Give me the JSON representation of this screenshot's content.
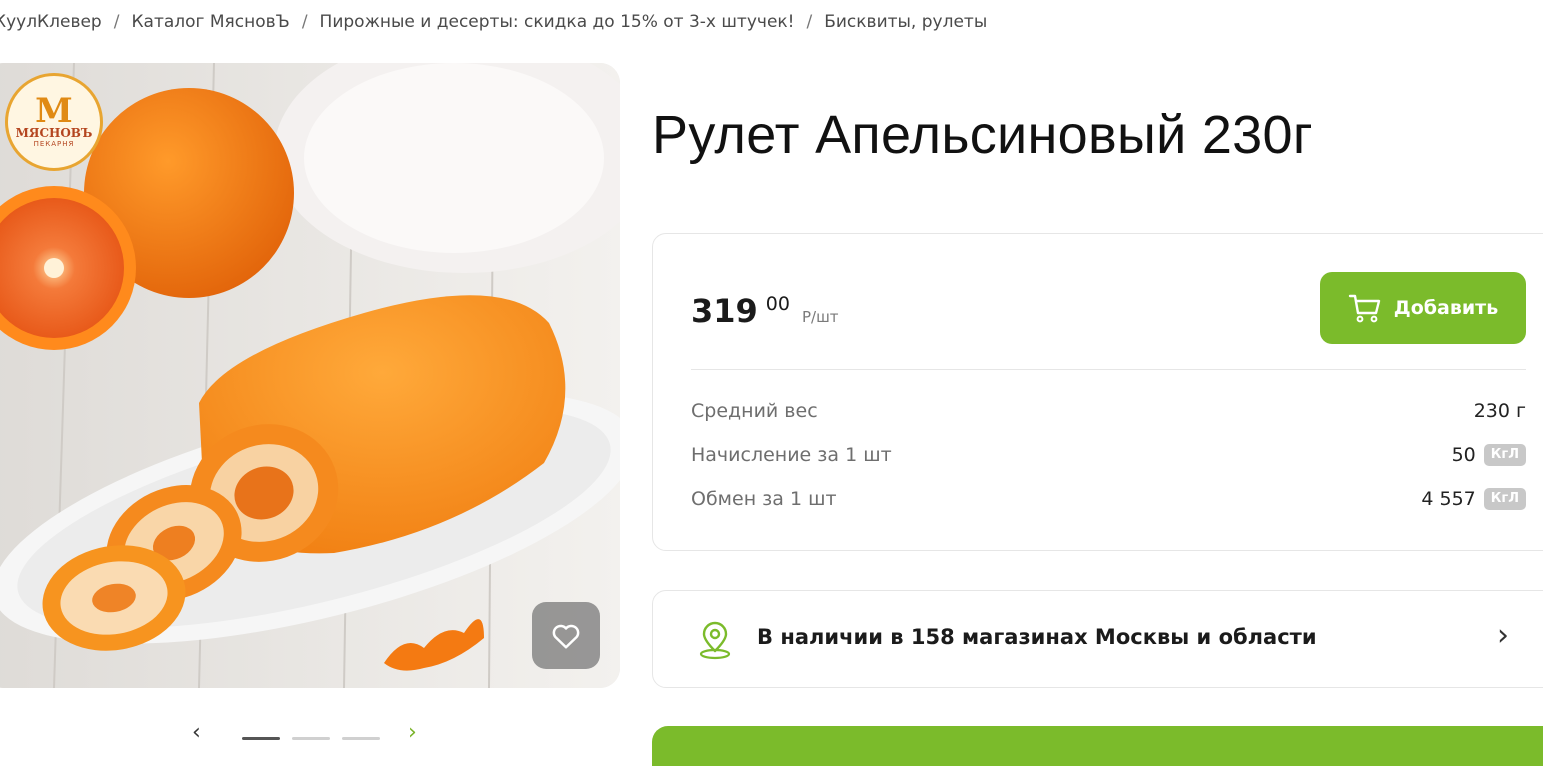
{
  "breadcrumb": [
    "КуулКлевер",
    "Каталог МясновЪ",
    "Пирожные и десерты: скидка до 15% от 3-х штучек!",
    "Бисквиты, рулеты"
  ],
  "logo": {
    "letter": "М",
    "brand": "МЯСНОВЪ",
    "sub": "ПЕКАРНЯ"
  },
  "icons": {
    "favorite": "heart-icon",
    "cart": "cart-icon",
    "location": "map-pin-icon"
  },
  "product": {
    "title": "Рулет Апельсиновый 230г"
  },
  "price": {
    "rubles": "319",
    "kopecks": "00",
    "unit": "Р/шт"
  },
  "add_button": {
    "label": "Добавить"
  },
  "details": [
    {
      "label": "Средний вес",
      "value": "230 г"
    },
    {
      "label": "Начисление за 1 шт",
      "value": "50",
      "badge": "КгЛ"
    },
    {
      "label": "Обмен за 1 шт",
      "value": "4 557",
      "badge": "КгЛ"
    }
  ],
  "availability": {
    "text": "В наличии в 158 магазинах Москвы и области"
  },
  "carousel": {
    "total": 3,
    "active": 1
  },
  "colors": {
    "accent": "#7bbb2b",
    "badge": "#c8c8c8"
  }
}
